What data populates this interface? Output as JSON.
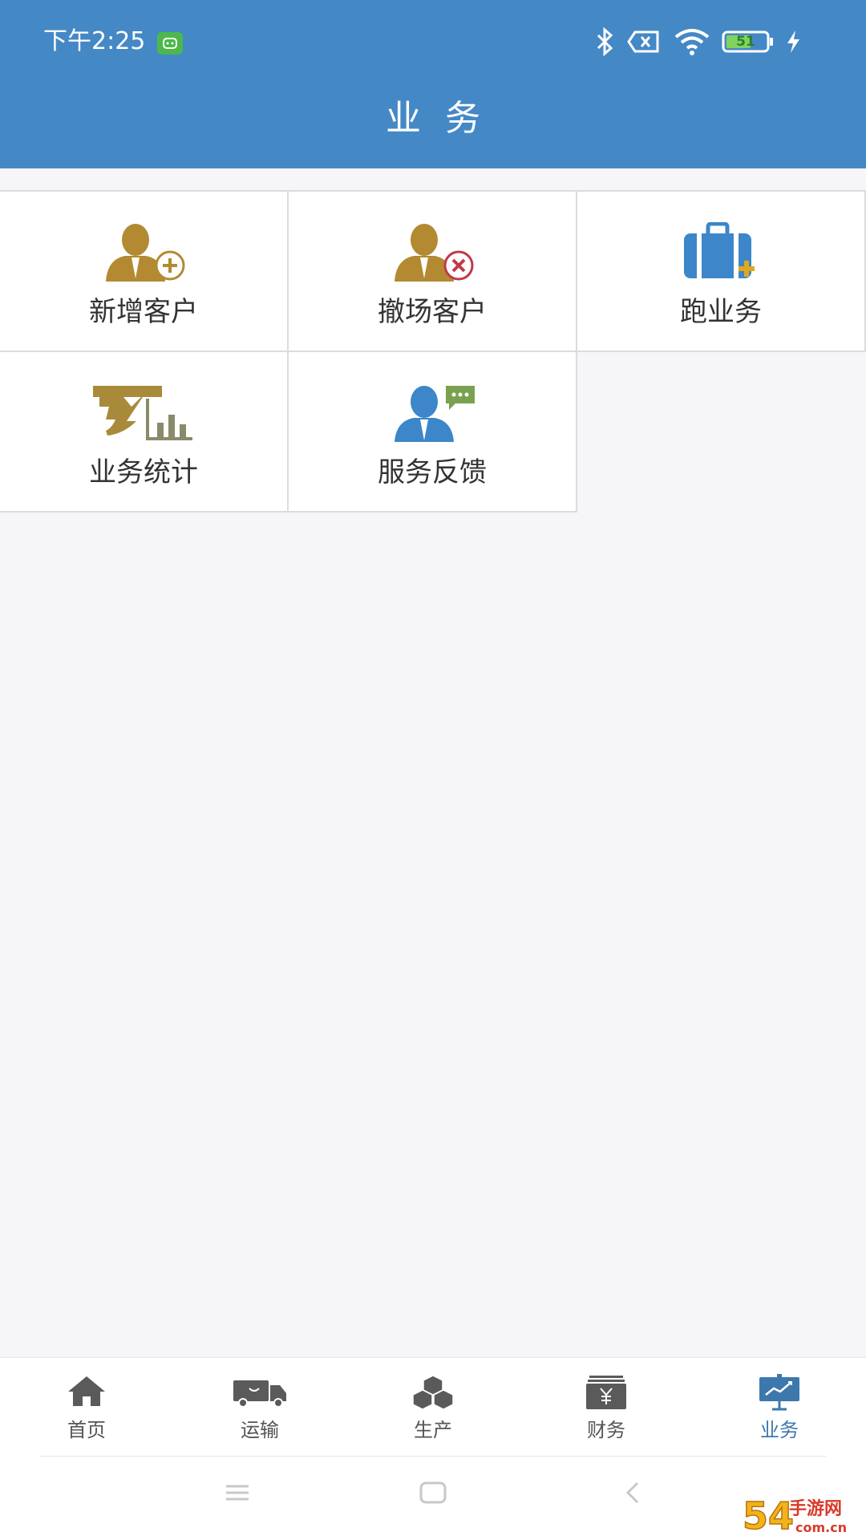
{
  "status_bar": {
    "time": "下午2:25",
    "battery": "51"
  },
  "header": {
    "title": "业务",
    "color": "#4588c6"
  },
  "grid": [
    {
      "label": "新增客户",
      "icon": "add-customer-icon"
    },
    {
      "label": "撤场客户",
      "icon": "remove-customer-icon"
    },
    {
      "label": "跑业务",
      "icon": "business-trip-icon"
    },
    {
      "label": "业务统计",
      "icon": "business-statistics-icon"
    },
    {
      "label": "服务反馈",
      "icon": "service-feedback-icon"
    }
  ],
  "bottom_nav": [
    {
      "label": "首页",
      "icon": "home-icon"
    },
    {
      "label": "运输",
      "icon": "truck-icon"
    },
    {
      "label": "生产",
      "icon": "boxes-icon"
    },
    {
      "label": "财务",
      "icon": "finance-icon"
    },
    {
      "label": "业务",
      "icon": "business-chart-icon",
      "active": true
    }
  ],
  "active_color": "#3d78ad",
  "watermark": {
    "brand": "54",
    "text": "手游网",
    "domain": "com.cn"
  }
}
